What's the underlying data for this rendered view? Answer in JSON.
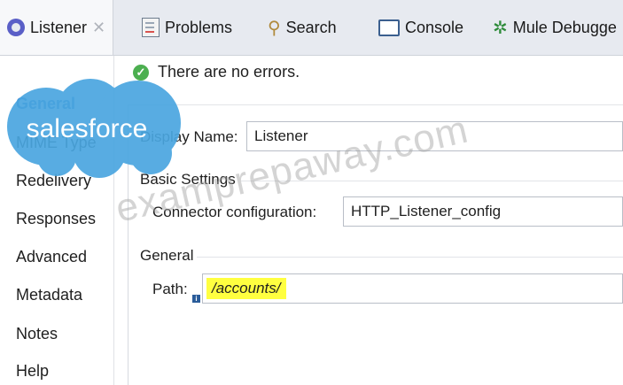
{
  "tabs": {
    "listener": "Listener",
    "problems": "Problems",
    "search": "Search",
    "console": "Console",
    "mule_debugger": "Mule Debugge"
  },
  "status": {
    "message": "There are no errors."
  },
  "left_nav": {
    "items": [
      "General",
      "MIME Type",
      "Redelivery",
      "Responses",
      "Advanced",
      "Metadata",
      "Notes",
      "Help"
    ]
  },
  "form": {
    "display_name_label": "Display Name:",
    "display_name_value": "Listener",
    "basic_settings_title": "Basic Settings",
    "connector_config_label": "Connector configuration:",
    "connector_config_value": "HTTP_Listener_config",
    "general_title": "General",
    "path_label": "Path:",
    "path_value": "/accounts/"
  },
  "overlays": {
    "brand": "salesforce",
    "watermark": "examprepaway.com"
  },
  "colors": {
    "accent_blue": "#2a7bd0",
    "cloud_blue": "#4aa6e0",
    "highlight": "#ffff40",
    "ok_green": "#4caf50"
  }
}
